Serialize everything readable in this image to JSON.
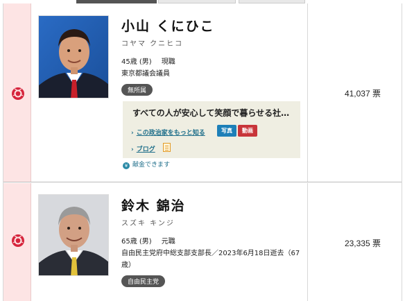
{
  "colors": {
    "mark_bg": "#fde4e4",
    "rose": "#d6243c",
    "party_badge": "#555555",
    "photo_badge": "#1d7fb8",
    "video_badge": "#c8353a",
    "link": "#1e6e8a",
    "highlight_box": "#efeee2"
  },
  "candidates": [
    {
      "mark_icon": "rose-icon",
      "name": "小山 くにひこ",
      "kana": "コヤマ クニヒコ",
      "age_sex": "45歳 (男)",
      "status": "現職",
      "title": "東京都議会議員",
      "party": "無所属",
      "slogan": "すべての人が安心して笑顔で暮らせる社…",
      "links": {
        "more": "この政治家をもっと知る",
        "photo": "写真",
        "video": "動画",
        "blog": "ブログ"
      },
      "donate": "献金できます",
      "votes": "41,037 票"
    },
    {
      "mark_icon": "rose-icon",
      "name": "鈴木 錦治",
      "kana": "スズキ キンジ",
      "age_sex": "65歳 (男)",
      "status": "元職",
      "title": "自由民主党府中総支部支部長／2023年6月18日逝去（67歳）",
      "party": "自由民主党",
      "votes": "23,335 票"
    }
  ]
}
